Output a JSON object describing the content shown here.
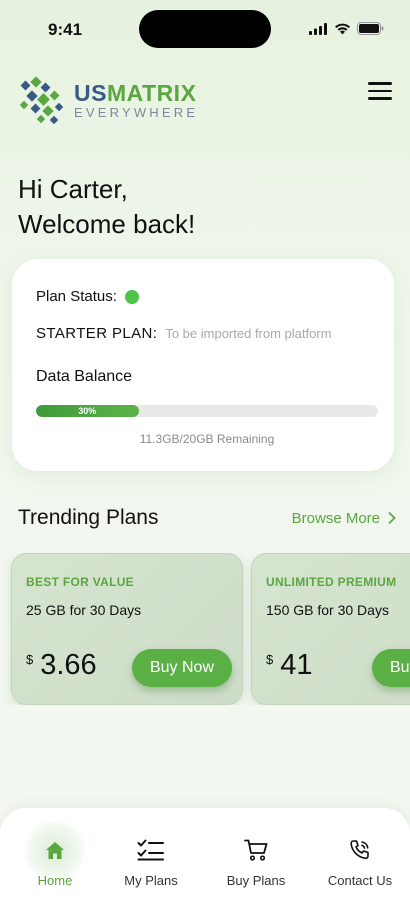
{
  "status_bar": {
    "time": "9:41"
  },
  "brand": {
    "name_part1": "US",
    "name_part2": "MATRIX",
    "tagline": "EVERYWHERE",
    "accent_color": "#5aa640",
    "dark_color": "#3a5a86"
  },
  "greeting": {
    "line1": "Hi Carter,",
    "line2": "Welcome back!"
  },
  "plan_card": {
    "status_label": "Plan Status:",
    "status_color": "#4fc24a",
    "plan_name": "STARTER PLAN:",
    "plan_note": "To be imported from platform",
    "data_balance_label": "Data Balance",
    "progress_percent": 30,
    "progress_text": "30%",
    "remaining_text": "11.3GB/20GB  Remaining"
  },
  "trending": {
    "title": "Trending Plans",
    "browse_more": "Browse More",
    "plans": [
      {
        "tag": "BEST FOR VALUE",
        "description": "25 GB for 30 Days",
        "currency": "$",
        "price": "3.66",
        "button": "Buy Now"
      },
      {
        "tag": "UNLIMITED PREMIUM",
        "description": "150 GB for 30 Days",
        "currency": "$",
        "price": "41",
        "button": "Buy Now"
      }
    ]
  },
  "bottom_nav": {
    "items": [
      {
        "label": "Home",
        "icon": "home-icon",
        "active": true
      },
      {
        "label": "My Plans",
        "icon": "checklist-icon",
        "active": false
      },
      {
        "label": "Buy Plans",
        "icon": "cart-icon",
        "active": false
      },
      {
        "label": "Contact Us",
        "icon": "phone-icon",
        "active": false
      }
    ]
  }
}
